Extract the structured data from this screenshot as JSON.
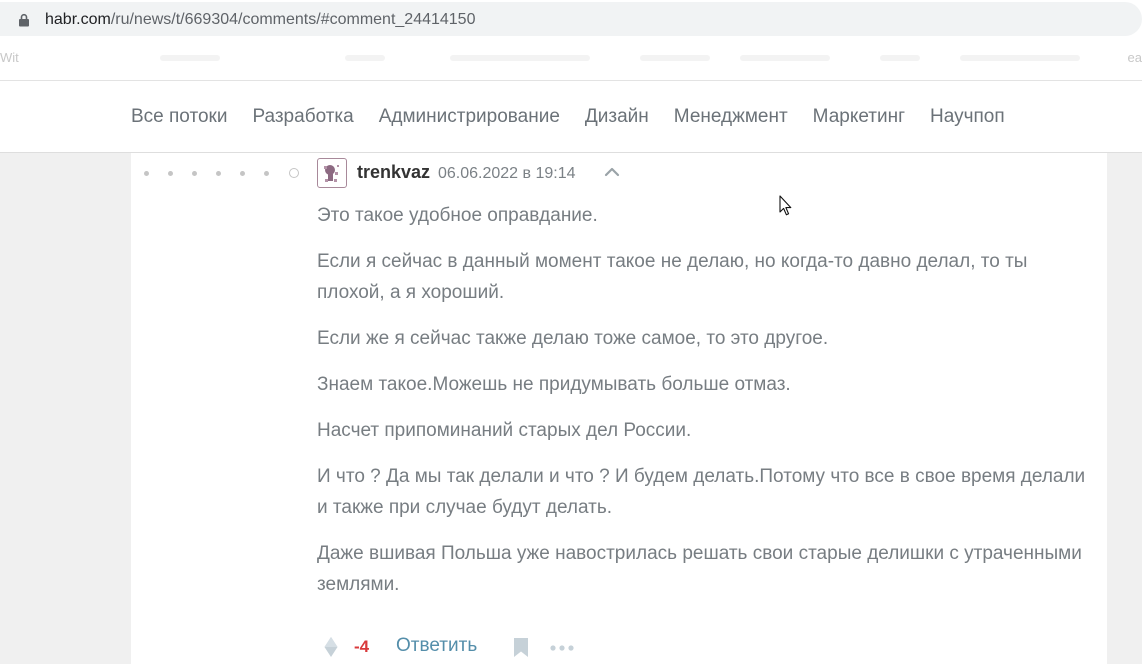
{
  "browser": {
    "url_host": "habr.com",
    "url_path": "/ru/news/t/669304/comments/#comment_24414150",
    "bookmark_left_fragment": "Wit",
    "bookmark_right_fragment": "ea"
  },
  "nav": {
    "items": [
      "Все потоки",
      "Разработка",
      "Администрирование",
      "Дизайн",
      "Менеджмент",
      "Маркетинг",
      "Научпоп"
    ]
  },
  "comment": {
    "author": "trenkvaz",
    "timestamp": "06.06.2022 в 19:14",
    "paragraphs": [
      "Это такое удобное оправдание.",
      "Если я сейчас в данный момент такое не делаю, но когда-то давно делал, то ты плохой, а я хороший.",
      "Если же я сейчас также делаю тоже самое, то это другое.",
      "Знаем такое.Можешь не придумывать больше отмаз.",
      "Насчет припоминаний старых дел России.",
      "И что ? Да мы так делали и что ? И будем делать.Потому что все в свое время делали и также при случае будут делать.",
      "Даже вшивая Польша уже навострилась решать свои старые делишки с утраченными землями."
    ],
    "score": "-4",
    "reply_label": "Ответить"
  },
  "colors": {
    "score_negative": "#d9393b",
    "reply_link": "#548eaa",
    "nav_text": "#6b7278"
  },
  "icons": [
    "lock-icon",
    "avatar-icon",
    "chevron-up-icon",
    "vote-diamond-icon",
    "bookmark-icon",
    "more-dots-icon",
    "mouse-cursor-icon"
  ]
}
